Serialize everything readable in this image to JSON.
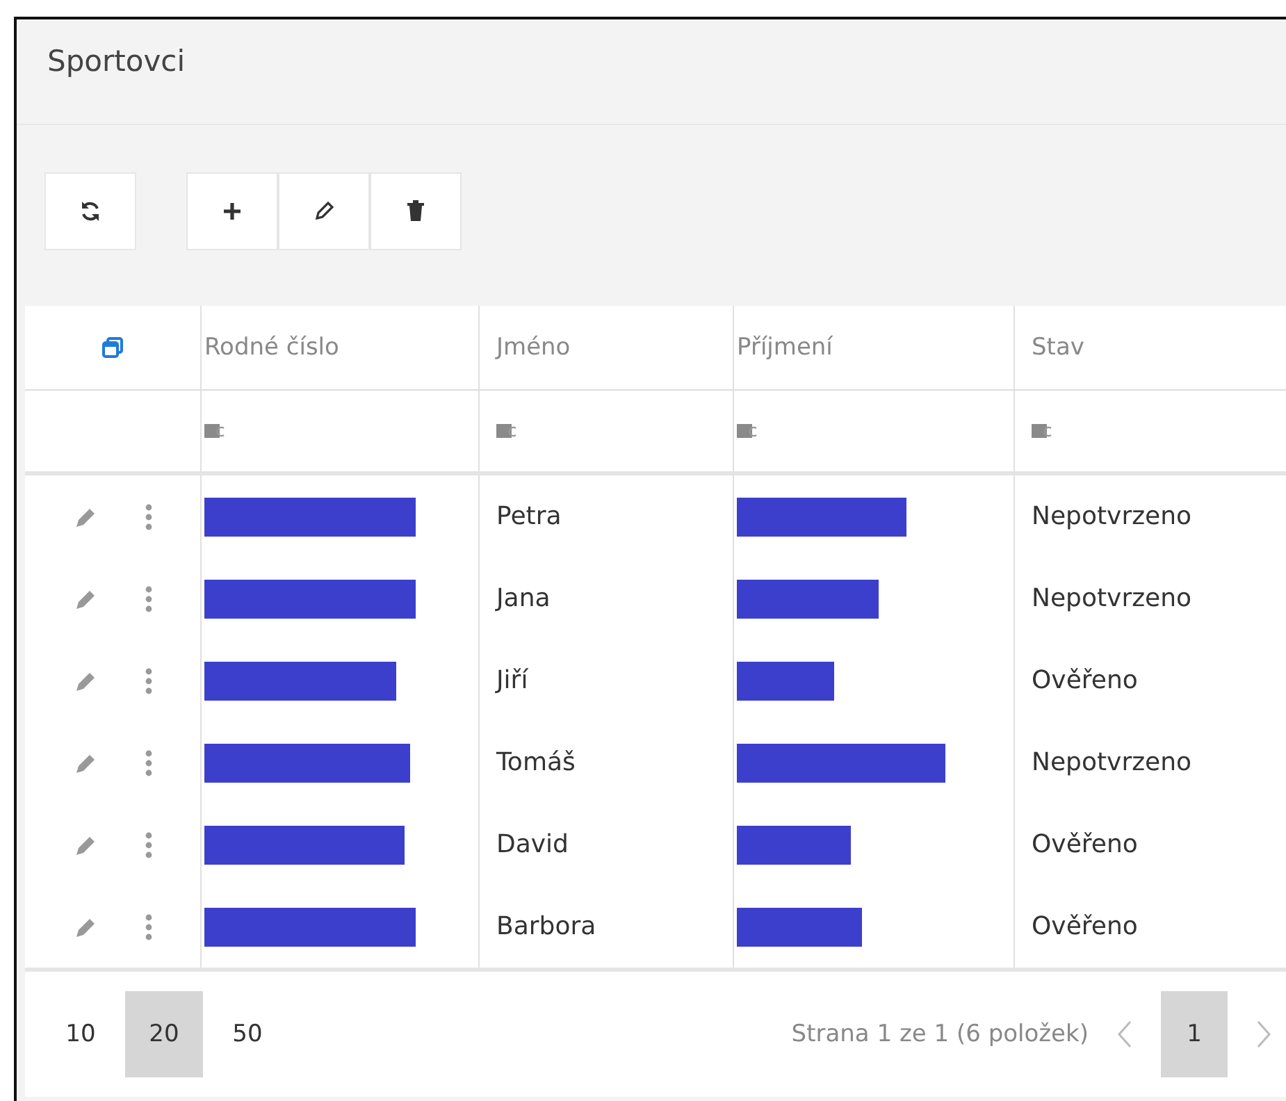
{
  "window": {
    "title": "Sportovci"
  },
  "toolbar": {
    "buttons": [
      {
        "kind": "refresh"
      },
      {
        "kind": "add"
      },
      {
        "kind": "edit"
      },
      {
        "kind": "delete"
      }
    ]
  },
  "table": {
    "columns": [
      "Rodné číslo",
      "Jméno",
      "Příjmení",
      "Stav"
    ],
    "rows": [
      {
        "jmeno": "Petra",
        "stav": "Nepotvrzeno"
      },
      {
        "jmeno": "Jana",
        "stav": "Nepotvrzeno"
      },
      {
        "jmeno": "Jiří",
        "stav": "Ověřeno"
      },
      {
        "jmeno": "Tomáš",
        "stav": "Nepotvrzeno"
      },
      {
        "jmeno": "David",
        "stav": "Ověřeno"
      },
      {
        "jmeno": "Barbora",
        "stav": "Ověřeno"
      }
    ]
  },
  "pager": {
    "sizes": [
      {
        "label": "10",
        "selected": false
      },
      {
        "label": "20",
        "selected": true
      },
      {
        "label": "50",
        "selected": false
      }
    ],
    "info": "Strana 1 ze 1 (6 položek)",
    "pages": [
      {
        "label": "1",
        "selected": true
      }
    ]
  }
}
